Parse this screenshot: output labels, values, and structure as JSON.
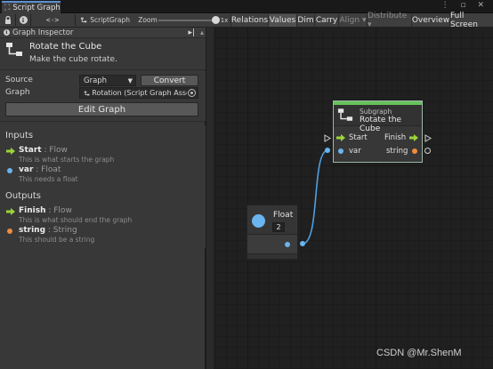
{
  "window": {
    "tab_title": "Script Graph",
    "title_controls": "⋮ ▫ ✕"
  },
  "toolbar": {
    "lock_glyph": "🔒",
    "info_glyph": "ℹ",
    "code_glyph": "<·>",
    "graph_name": "ScriptGraph",
    "zoom_label": "Zoom",
    "zoom_value_label": "1x",
    "zoom_level": 1,
    "relations_label": "Relations",
    "values_label": "Values",
    "dim_label": "Dim",
    "carry_label": "Carry",
    "align_label": "Align ▾",
    "distribute_label": "Distribute ▾",
    "overview_label": "Overview",
    "fullscreen_label": "Full Screen"
  },
  "inspector": {
    "header": "Graph Inspector",
    "pin_glyph": "▸|",
    "title": "Rotate the Cube",
    "summary": "Make the cube rotate.",
    "source_label": "Source",
    "source_value": "Graph",
    "convert_label": "Convert",
    "graph_label": "Graph",
    "graph_value": "Rotation (Script Graph Asset)",
    "edit_graph_label": "Edit Graph",
    "inputs_header": "Inputs",
    "inputs": [
      {
        "name": "Start",
        "type": " : Flow",
        "desc": "This is what starts the graph",
        "kind": "flow"
      },
      {
        "name": "var",
        "type": " : Float",
        "desc": "This needs a float",
        "kind": "value"
      }
    ],
    "outputs_header": "Outputs",
    "outputs": [
      {
        "name": "Finish",
        "type": " : Flow",
        "desc": "This is what should end the graph",
        "kind": "flow"
      },
      {
        "name": "string",
        "type": " : String",
        "desc": "This should be a string",
        "kind": "string"
      }
    ]
  },
  "nodes": {
    "subgraph": {
      "kind": "Subgraph",
      "title": "Rotate the Cube",
      "in_flow": "Start",
      "in_value": "var",
      "out_flow": "Finish",
      "out_value": "string"
    },
    "float": {
      "title": "Float",
      "value": "2"
    }
  },
  "colors": {
    "flow_arrow": "#9bd43a",
    "float_port": "#6ab4f0",
    "string_port": "#f08c3c",
    "subgraph_accent": "#66c15a",
    "connection": "#4f9fe0"
  },
  "watermark": "CSDN @Mr.ShenM"
}
